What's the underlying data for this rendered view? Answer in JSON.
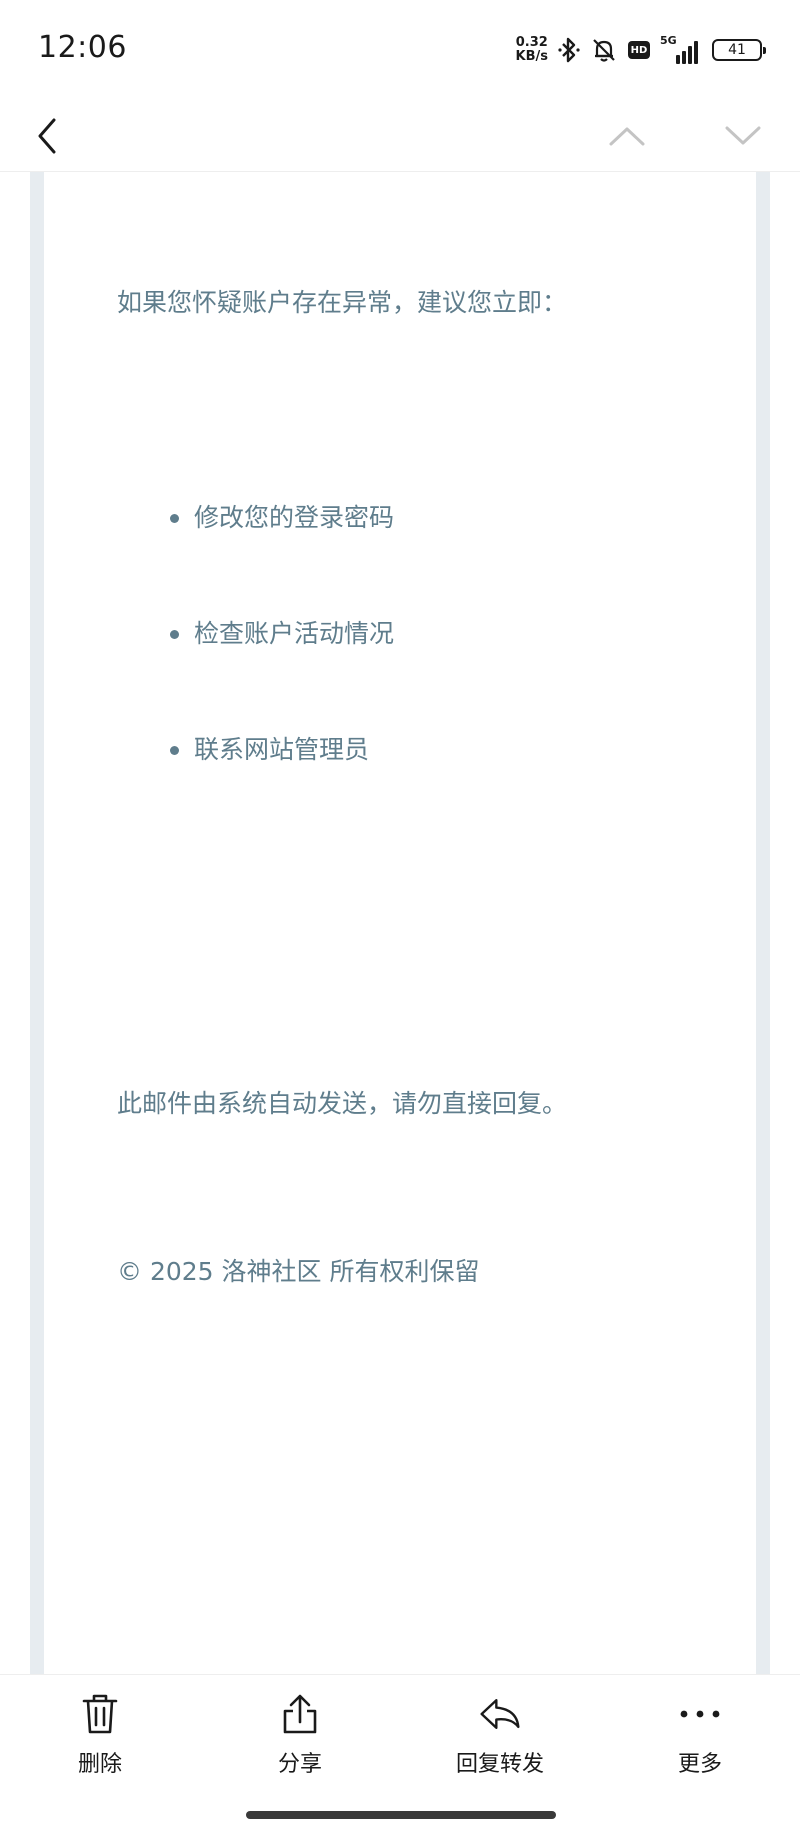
{
  "status": {
    "time": "12:06",
    "net_speed_value": "0.32",
    "net_speed_unit": "KB/s",
    "hd": "HD",
    "network": "5G",
    "battery": "41",
    "icons": [
      "bluetooth-icon",
      "bell-muted-icon",
      "hd-icon",
      "signal-icon",
      "battery-icon"
    ]
  },
  "nav": {
    "icons": [
      "back-icon",
      "chevron-up-icon",
      "chevron-down-icon"
    ]
  },
  "email": {
    "intro": "如果您怀疑账户存在异常，建议您立即：",
    "bullets": [
      "修改您的登录密码",
      "检查账户活动情况",
      "联系网站管理员"
    ],
    "notice": "此邮件由系统自动发送，请勿直接回复。",
    "copyright": "© 2025 洛神社区 所有权利保留",
    "text_color": "#5f7d8c",
    "gutter_color": "#e7ecf0"
  },
  "toolbar": {
    "delete_label": "删除",
    "share_label": "分享",
    "reply_label": "回复转发",
    "more_label": "更多"
  }
}
